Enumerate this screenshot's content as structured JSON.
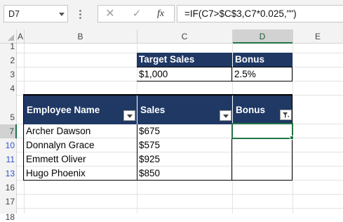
{
  "name_box": {
    "value": "D7"
  },
  "formula_bar": {
    "cancel_glyph": "✕",
    "enter_glyph": "✓",
    "fx_label": "fx",
    "formula": "=IF(C7>$C$3,C7*0.025,\"\")"
  },
  "columns": [
    "A",
    "B",
    "C",
    "D",
    "E"
  ],
  "selected_column": "D",
  "rows": [
    "1",
    "2",
    "3",
    "4",
    "5",
    "7",
    "10",
    "11",
    "13",
    "16",
    "17",
    "18"
  ],
  "selected_row": "7",
  "filtered_rows_color": "#3052c8",
  "top_table": {
    "headers": [
      "Target Sales",
      "Bonus"
    ],
    "values": [
      "$1,000",
      "2.5%"
    ]
  },
  "table": {
    "header_color": "#1f3864",
    "headers": [
      "Employee Name",
      "Sales",
      "Bonus"
    ],
    "bonus_filter_active": true,
    "rows": [
      {
        "name": "Archer Dawson",
        "sales": "$675",
        "bonus": ""
      },
      {
        "name": "Donnalyn Grace",
        "sales": "$575",
        "bonus": ""
      },
      {
        "name": "Emmett Oliver",
        "sales": "$925",
        "bonus": ""
      },
      {
        "name": "Hugo Phoenix",
        "sales": "$850",
        "bonus": ""
      }
    ]
  },
  "active_cell": "D7",
  "accent_color": "#217346"
}
